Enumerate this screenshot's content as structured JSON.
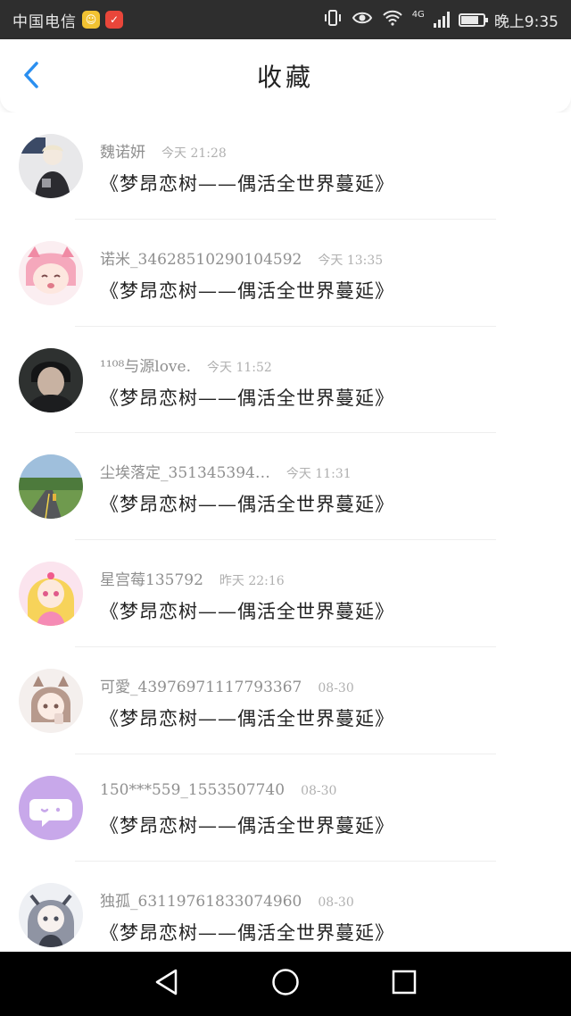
{
  "status_bar": {
    "carrier": "中国电信",
    "network": "4G",
    "clock": "晚上9:35",
    "battery_level": 0.8
  },
  "header": {
    "title": "收藏",
    "back_icon": "chevron-left-icon",
    "accent": "#2a8ff0"
  },
  "favorites": [
    {
      "name": "魏诺妍",
      "time": "今天 21:28",
      "post": "《梦昂恋树——偶活全世界蔓延》",
      "avatar": "avatar-anime-girl-dark-coat"
    },
    {
      "name": "诺米_346285102901045​92",
      "time": "今天 13:35",
      "post": "《梦昂恋树——偶活全世界蔓延》",
      "avatar": "avatar-pink-hair-girl"
    },
    {
      "name": "¹¹⁰⁸与源love.",
      "time": "今天 11:52",
      "post": "《梦昂恋树——偶活全世界蔓延》",
      "avatar": "avatar-dark-portrait"
    },
    {
      "name": "尘埃落定_351345394…",
      "time": "今天 11:31",
      "post": "《梦昂恋树——偶活全世界蔓延》",
      "avatar": "avatar-road-landscape"
    },
    {
      "name": "星宫莓135792",
      "time": "昨天 22:16",
      "post": "《梦昂恋树——偶活全世界蔓延》",
      "avatar": "avatar-idol-blonde-girl"
    },
    {
      "name": "可愛_43976971117793367",
      "time": "08-30",
      "post": "《梦昂恋树——偶活全世界蔓延》",
      "avatar": "avatar-cat-ear-girl"
    },
    {
      "name": "150***559_1553507740",
      "time": "08-30",
      "post": "《梦昂恋树——偶活全世界蔓延》",
      "avatar": "avatar-default-chat-bubble"
    },
    {
      "name": "独孤_63119761833074960",
      "time": "08-30",
      "post": "《梦昂恋树——偶活全世界蔓延》",
      "avatar": "avatar-silver-hair-girl"
    }
  ],
  "system_nav": {
    "back": "triangle-back-icon",
    "home": "circle-home-icon",
    "recents": "square-recents-icon"
  }
}
